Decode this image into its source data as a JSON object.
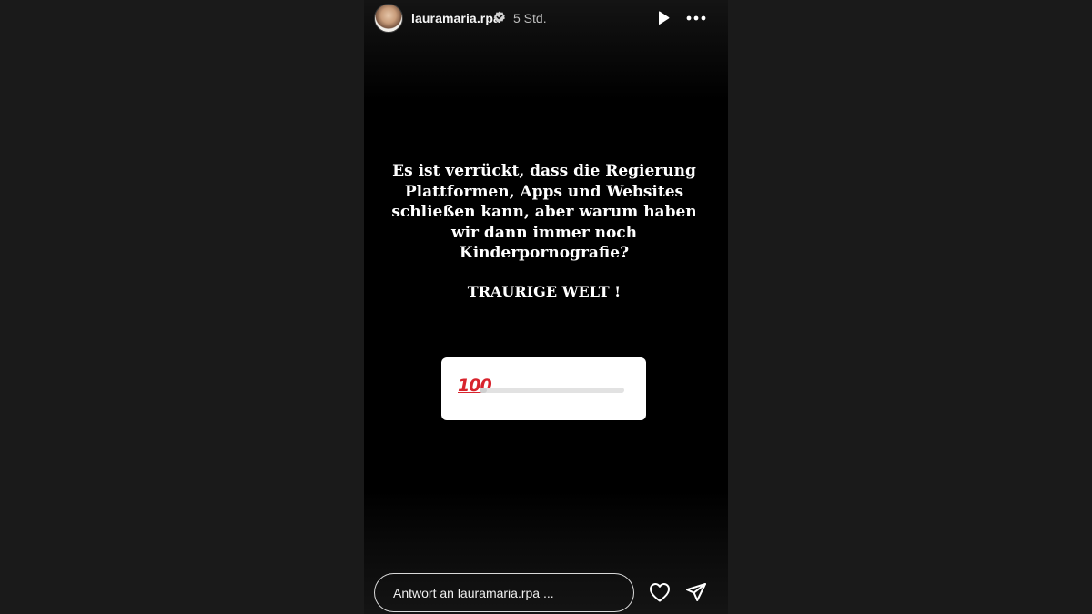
{
  "header": {
    "username": "lauramaria.rpa",
    "time_ago": "5 Std.",
    "avatar_icon": "avatar-photo",
    "verified_icon": "verified-badge-icon",
    "play_icon": "play-icon",
    "more_icon": "more-dots-icon"
  },
  "story": {
    "text_lines": [
      "Es ist verrückt, dass die Regierung",
      "Plattformen, Apps und Websites",
      "schließen kann, aber warum haben",
      "wir dann immer noch",
      "Kinderpornografie?"
    ],
    "subtext": "TRAURIGE WELT !",
    "slider": {
      "emoji_text": "100",
      "fill_fraction": 0.05
    }
  },
  "footer": {
    "reply_placeholder": "Antwort an lauramaria.rpa ...",
    "heart_icon": "heart-outline-icon",
    "send_icon": "paper-plane-icon"
  },
  "colors": {
    "background": "#1a1a1a",
    "story_background": "#000000",
    "text": "#ffffff",
    "emoji_red": "#d8242d"
  }
}
